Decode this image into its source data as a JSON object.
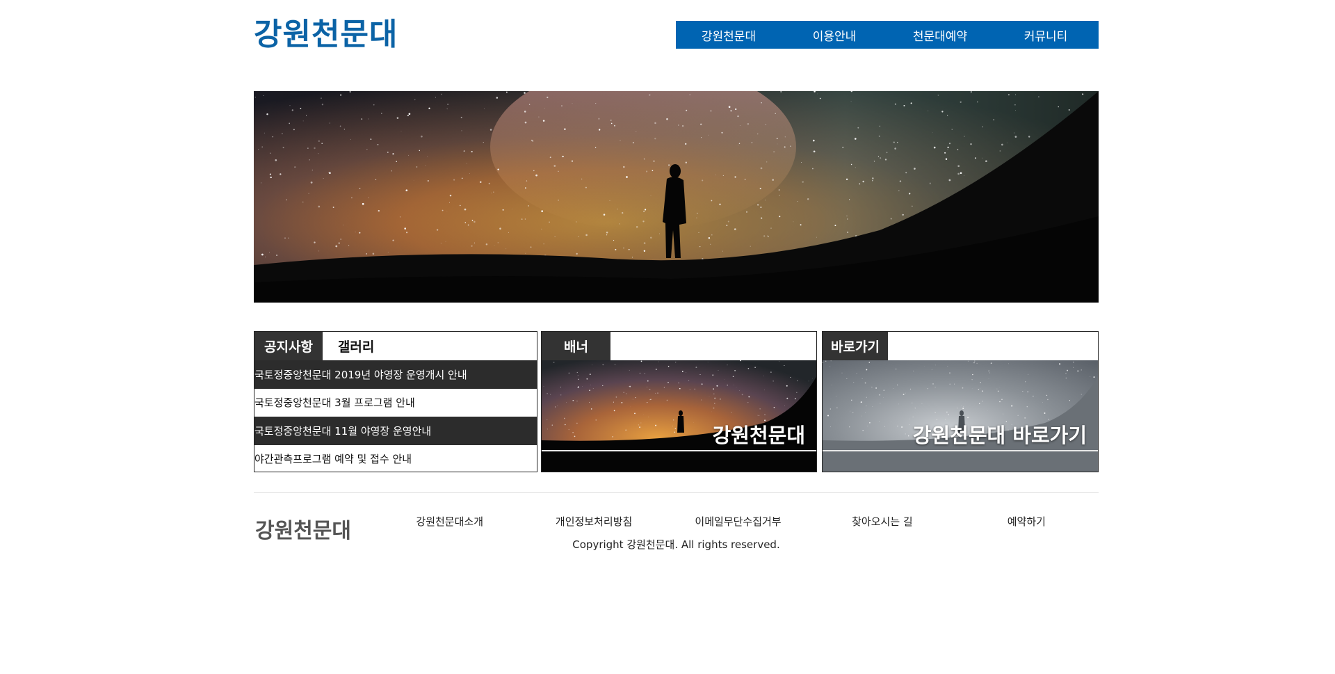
{
  "header": {
    "logo": "강원천문대",
    "nav": [
      "강원천문대",
      "이용안내",
      "천문대예약",
      "커뮤니티"
    ]
  },
  "notice": {
    "tabs": [
      "공지사항",
      "갤러리"
    ],
    "items": [
      "국토정중앙천문대 2019년 야영장 운영개시 안내",
      "국토정중앙천문대 3월 프로그램 안내",
      "국토정중앙천문대 11월 야영장 운영안내",
      "야간관측프로그램 예약 및 접수 안내"
    ]
  },
  "banner": {
    "tab": "배너",
    "caption": "강원천문대"
  },
  "shortcut": {
    "tab": "바로가기",
    "caption": "강원천문대 바로가기"
  },
  "footer": {
    "logo": "강원천문대",
    "links": [
      "강원천문대소개",
      "개인정보처리방침",
      "이메일무단수집거부",
      "찾아오시는 길",
      "예약하기"
    ],
    "copyright": "Copyright 강원천문대. All rights reserved."
  },
  "colors": {
    "brand": "#0b63a6",
    "nav_bg": "#0064b2",
    "tab_active": "#333333",
    "notice_dark": "#2c2c2c"
  }
}
